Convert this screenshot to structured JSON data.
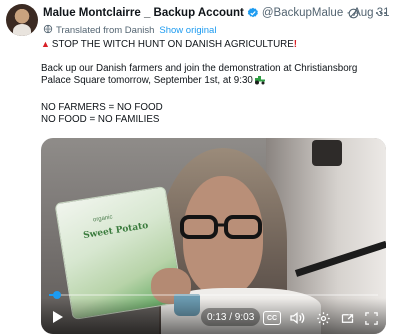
{
  "author": {
    "display_name": "Malue Montclairre _ Backup Account",
    "handle": "@BackupMalue",
    "separator": "·",
    "date": "Aug 31"
  },
  "translation": {
    "label": "Translated from Danish",
    "show_original": "Show original"
  },
  "tweet": {
    "line1": "STOP THE WITCH HUNT ON DANISH AGRICULTURE",
    "line1_suffix": "!",
    "paragraph2": "Back up our Danish farmers and join the demonstration at Christiansborg Palace Square tomorrow, September 1st, at 9:30",
    "line3": "NO FARMERS = NO FOOD",
    "line4": "NO FOOD = NO FAMILIES"
  },
  "video": {
    "product_label": "Sweet Potato",
    "product_sub": "organic",
    "time_display": "0:13 / 9:03",
    "cc_label": "CC",
    "progress": 0.024
  },
  "colors": {
    "accent": "#1d9bf0",
    "text": "#0f1419",
    "muted": "#536471",
    "siren": "#d81f26"
  },
  "icons": {
    "verified": "verified-badge-icon",
    "grok": "grok-icon",
    "more": "more-icon",
    "translate": "translate-icon",
    "siren": "siren-icon",
    "tractor": "tractor-icon",
    "play": "play-icon",
    "volume": "volume-icon",
    "settings": "settings-icon",
    "pip": "picture-in-picture-icon",
    "fullscreen": "fullscreen-icon"
  }
}
